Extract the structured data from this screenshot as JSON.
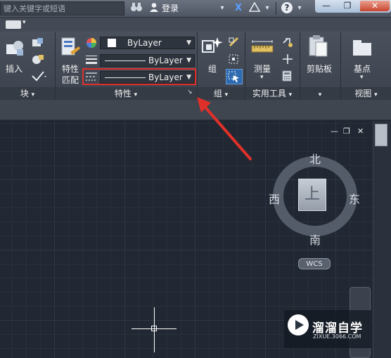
{
  "search": {
    "placeholder": "键入关键字或短语"
  },
  "topbar": {
    "binoculars_icon": "binoculars-icon",
    "login_label": "登录",
    "dropdown_arrow": "▾",
    "x_label": "X",
    "help_label": "?"
  },
  "window": {
    "minimize": "—",
    "restore": "❐",
    "close": "✕"
  },
  "ribbon": {
    "block_panel": {
      "insert_label": "插入",
      "title": "块"
    },
    "properties_panel": {
      "match_label_line1": "特性",
      "match_label_line2": "匹配",
      "color_value": "ByLayer",
      "lineweight_value": "ByLayer",
      "linetype_value": "ByLayer",
      "title": "特性"
    },
    "groups_panel": {
      "group_label": "组",
      "title": "组"
    },
    "utilities_panel": {
      "measure_label": "测量",
      "title": "实用工具"
    },
    "clipboard_panel": {
      "clipboard_label": "剪贴板"
    },
    "view_panel": {
      "base_label": "基点",
      "title": "视图"
    }
  },
  "viewport": {
    "minimize": "—",
    "restore": "❐",
    "close": "✕"
  },
  "viewcube": {
    "north": "北",
    "south": "南",
    "east": "东",
    "west": "西",
    "top_face": "上",
    "wcs_label": "WCS"
  },
  "watermark": {
    "brand": "溜溜自学",
    "url": "ZIXUE.3066.COM"
  },
  "colors": {
    "highlight": "#e0302a",
    "arrow": "#e0302a",
    "background": "#212833"
  }
}
